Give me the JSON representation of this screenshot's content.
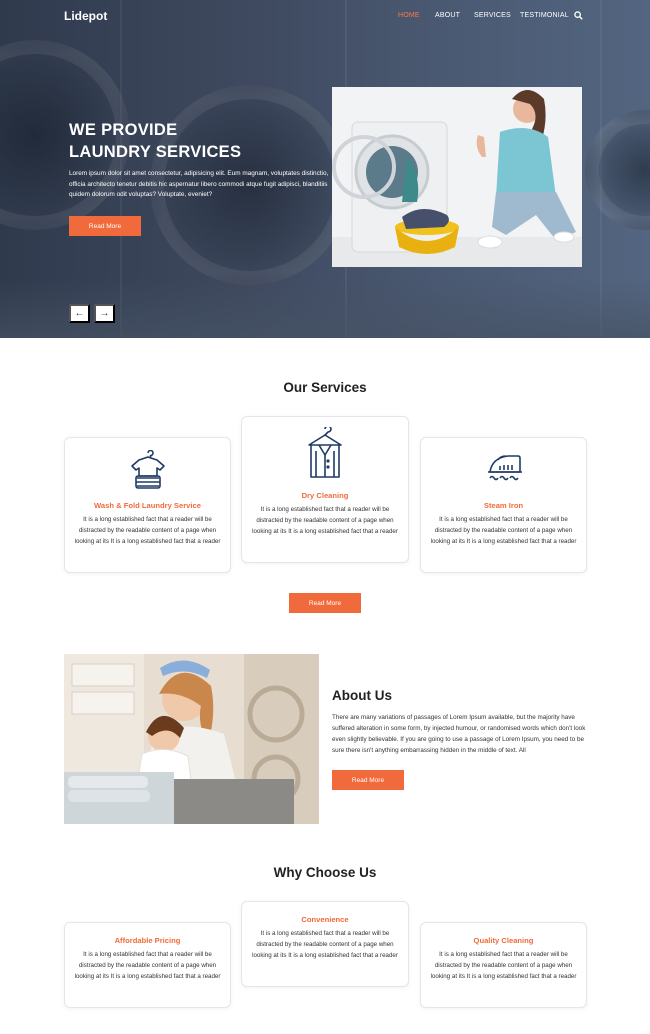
{
  "nav": {
    "logo": "Lidepot",
    "items": [
      {
        "label": "HOME",
        "active": true
      },
      {
        "label": "ABOUT",
        "active": false
      },
      {
        "label": "SERVICES",
        "active": false
      },
      {
        "label": "TESTIMONIAL",
        "active": false
      }
    ],
    "search_icon": "search-icon"
  },
  "hero": {
    "title_line1": "WE PROVIDE",
    "title_line2": "LAUNDRY SERVICES",
    "text": "Lorem ipsum dolor sit amet consectetur, adipisicing elit. Eum magnam, voluptates distinctio, officia architecto tenetur debitis hic aspernatur libero commodi atque fugit adipisci, blanditiis quidem dolorum odit voluptas? Voluptate, eveniet?",
    "button": "Read More",
    "prev_icon": "←",
    "next_icon": "→"
  },
  "services": {
    "title": "Our Services",
    "button": "Read More",
    "cards": [
      {
        "title": "Wash & Fold Laundry Service",
        "text": "It is a long established fact that a reader will be distracted by the readable content of a page when looking at its It is a long established fact that a reader",
        "icon": "folded-shirt-icon"
      },
      {
        "title": "Dry Cleaning",
        "text": "It is a long established fact that a reader will be distracted by the readable content of a page when looking at its It is a long established fact that a reader",
        "icon": "garment-bag-icon"
      },
      {
        "title": "Steam Iron",
        "text": "It is a long established fact that a reader will be distracted by the readable content of a page when looking at its It is a long established fact that a reader",
        "icon": "steam-iron-icon"
      }
    ]
  },
  "about": {
    "title": "About Us",
    "text": "There are many variations of passages of Lorem Ipsum available, but the majority have suffered alteration in some form, by injected humour, or randomised words which don't look even slightly believable. If you are going to use a passage of Lorem Ipsum, you need to be sure there isn't anything embarrassing hidden in the middle of text. All",
    "button": "Read More"
  },
  "why": {
    "title": "Why Choose Us",
    "cards": [
      {
        "title": "Affordable Pricing",
        "text": "It is a long established fact that a reader will be distracted by the readable content of a page when looking at its It is a long established fact that a reader"
      },
      {
        "title": "Convenience",
        "text": "It is a long established fact that a reader will be distracted by the readable content of a page when looking at its It is a long established fact that a reader"
      },
      {
        "title": "Quality Cleaning",
        "text": "It is a long established fact that a reader will be distracted by the readable content of a page when looking at its It is a long established fact that a reader"
      }
    ]
  },
  "colors": {
    "accent": "#f16a3b",
    "hero_bg": "#3f4a60",
    "icon_navy": "#1f3a66"
  }
}
